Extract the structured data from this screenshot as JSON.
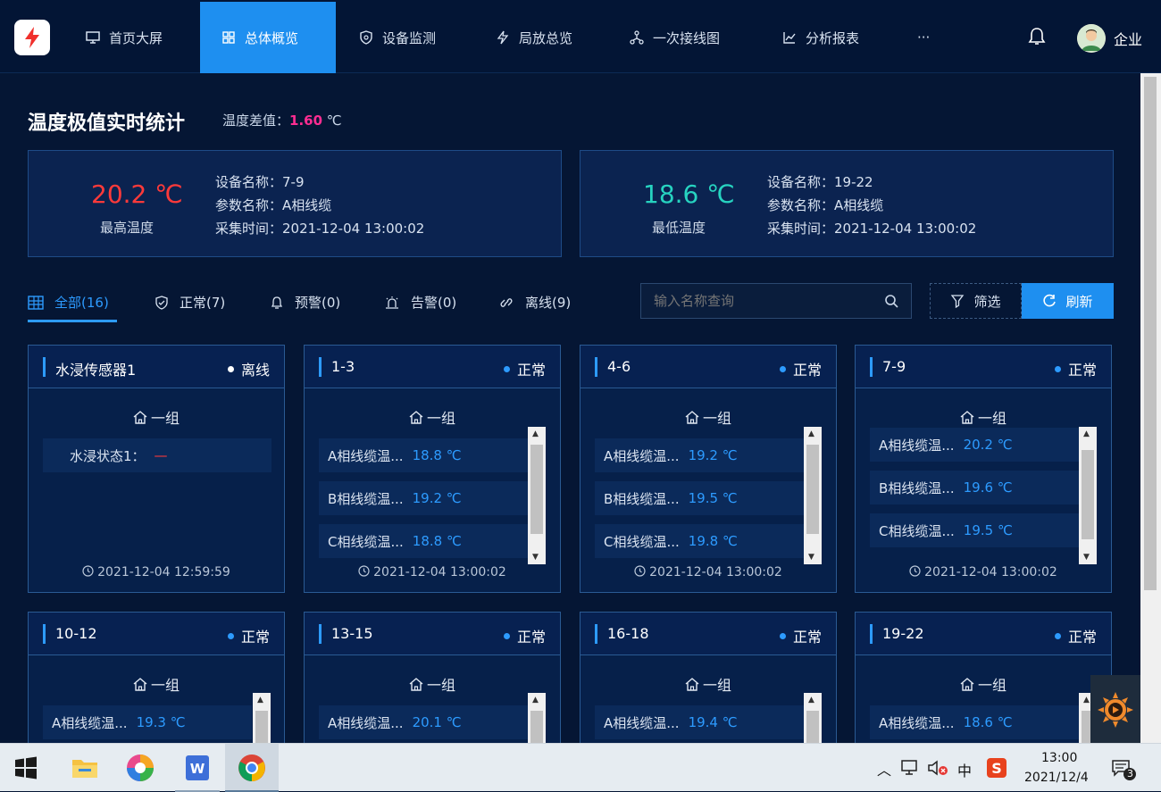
{
  "nav": {
    "items": [
      {
        "label": "首页大屏",
        "icon": "monitor-icon"
      },
      {
        "label": "总体概览",
        "icon": "grid-icon",
        "active": true
      },
      {
        "label": "设备监测",
        "icon": "shield-icon"
      },
      {
        "label": "局放总览",
        "icon": "bolt-icon"
      },
      {
        "label": "一次接线图",
        "icon": "network-icon"
      },
      {
        "label": "分析报表",
        "icon": "chart-icon"
      },
      {
        "label": "···",
        "icon": ""
      }
    ],
    "user": "企业"
  },
  "stats": {
    "title": "温度极值实时统计",
    "diff_label": "温度差值：",
    "diff_value": "1.60",
    "diff_unit": " ℃",
    "max": {
      "temp": "20.2 ℃",
      "label": "最高温度",
      "device": "设备名称：7-9",
      "param": "参数名称：A相线缆",
      "time": "采集时间：2021-12-04 13:00:02",
      "color": "#ff3a3a"
    },
    "min": {
      "temp": "18.6 ℃",
      "label": "最低温度",
      "device": "设备名称：19-22",
      "param": "参数名称：A相线缆",
      "time": "采集时间：2021-12-04 13:00:02",
      "color": "#27d3c0"
    }
  },
  "tabs": [
    {
      "label": "全部(16)",
      "icon": "table-icon"
    },
    {
      "label": "正常(7)",
      "icon": "check-shield-icon"
    },
    {
      "label": "预警(0)",
      "icon": "bell-icon"
    },
    {
      "label": "告警(0)",
      "icon": "alarm-icon"
    },
    {
      "label": "离线(9)",
      "icon": "unlink-icon"
    }
  ],
  "search": {
    "placeholder": "输入名称查询"
  },
  "buttons": {
    "filter": "筛选",
    "refresh": "刷新"
  },
  "cards": [
    {
      "title": "水浸传感器1",
      "status": "离线",
      "status_color": "#ffffff",
      "group": "一组",
      "rows": [
        {
          "label": "水浸状态1：",
          "value": "—"
        }
      ],
      "time": "2021-12-04 12:59:59"
    },
    {
      "title": "1-3",
      "status": "正常",
      "status_color": "#2d9bff",
      "group": "一组",
      "rows": [
        {
          "label": "A相线缆温...",
          "value": "18.8 ℃"
        },
        {
          "label": "B相线缆温...",
          "value": "19.2 ℃"
        },
        {
          "label": "C相线缆温...",
          "value": "18.8 ℃"
        }
      ],
      "time": "2021-12-04 13:00:02"
    },
    {
      "title": "4-6",
      "status": "正常",
      "status_color": "#2d9bff",
      "group": "一组",
      "rows": [
        {
          "label": "A相线缆温...",
          "value": "19.2 ℃"
        },
        {
          "label": "B相线缆温...",
          "value": "19.5 ℃"
        },
        {
          "label": "C相线缆温...",
          "value": "19.8 ℃"
        }
      ],
      "time": "2021-12-04 13:00:02"
    },
    {
      "title": "7-9",
      "status": "正常",
      "status_color": "#2d9bff",
      "group": "一组",
      "rows": [
        {
          "label": "A相线缆温...",
          "value": "20.2 ℃"
        },
        {
          "label": "B相线缆温...",
          "value": "19.6 ℃"
        },
        {
          "label": "C相线缆温...",
          "value": "19.5 ℃"
        }
      ],
      "time": "2021-12-04 13:00:02"
    },
    {
      "title": "10-12",
      "status": "正常",
      "status_color": "#2d9bff",
      "group": "一组",
      "rows": [
        {
          "label": "A相线缆温...",
          "value": "19.3 ℃"
        }
      ]
    },
    {
      "title": "13-15",
      "status": "正常",
      "status_color": "#2d9bff",
      "group": "一组",
      "rows": [
        {
          "label": "A相线缆温...",
          "value": "20.1 ℃"
        }
      ]
    },
    {
      "title": "16-18",
      "status": "正常",
      "status_color": "#2d9bff",
      "group": "一组",
      "rows": [
        {
          "label": "A相线缆温...",
          "value": "19.4 ℃"
        }
      ]
    },
    {
      "title": "19-22",
      "status": "正常",
      "status_color": "#2d9bff",
      "group": "一组",
      "rows": [
        {
          "label": "A相线缆温...",
          "value": "18.6 ℃"
        }
      ]
    }
  ],
  "taskbar": {
    "ime": "中",
    "time": "13:00",
    "date": "2021/12/4",
    "notif_count": "3"
  }
}
